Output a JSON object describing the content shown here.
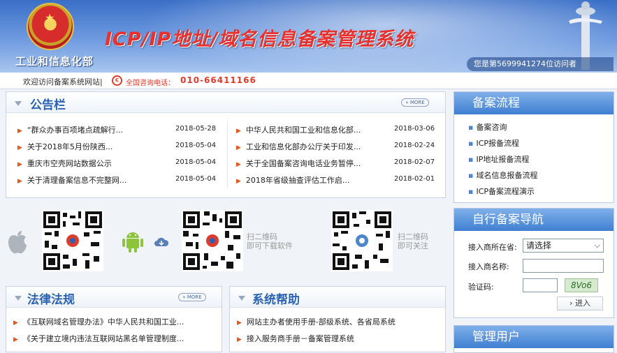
{
  "header": {
    "ministry": "工业和信息化部",
    "title": "ICP/IP地址/域名信息备案管理系统",
    "visitor": "您是第5699941274位访问者"
  },
  "subbar": {
    "welcome": "欢迎访问备案系统网站|",
    "phone_label": "全国咨询电话：",
    "phone_number": "010-66411166"
  },
  "notice": {
    "title": "公告栏",
    "more": "MORE",
    "left": [
      {
        "text": "“群众办事百项堵点疏解行...",
        "date": "2018-05-28"
      },
      {
        "text": "关于2018年5月份陕西...",
        "date": "2018-05-04"
      },
      {
        "text": "重庆市空壳网站数据公示",
        "date": "2018-05-04"
      },
      {
        "text": "关于清理备案信息不完整网...",
        "date": "2018-05-04"
      }
    ],
    "right": [
      {
        "text": "中华人民共和国工业和信息化部...",
        "date": "2018-03-06"
      },
      {
        "text": "工业和信息化部办公厅关于印发...",
        "date": "2018-02-24"
      },
      {
        "text": "关于全国备案咨询电话业务暂停...",
        "date": "2018-02-07"
      },
      {
        "text": "2018年省级抽查评估工作启...",
        "date": "2018-02-01"
      }
    ]
  },
  "qr": {
    "download": [
      "扫二维码",
      "即可下载软件"
    ],
    "follow": [
      "扫二维码",
      "即可关注"
    ]
  },
  "law": {
    "title": "法律法规",
    "more": "MORE",
    "items": [
      "《互联网域名管理办法》中华人民共和国工业...",
      "《关于建立境内违法互联网站黑名单管理制度..."
    ]
  },
  "help": {
    "title": "系统帮助",
    "items": [
      "网站主办者使用手册-部级系统、各省局系统",
      "接入服务商手册－备案管理系统"
    ]
  },
  "process": {
    "title": "备案流程",
    "items": [
      "备案咨询",
      "ICP报备流程",
      "IP地址报备流程",
      "域名信息报备流程",
      "ICP备案流程演示"
    ]
  },
  "nav": {
    "title": "自行备案导航",
    "provider_location_label": "接入商所在省:",
    "provider_location_value": "请选择",
    "provider_name_label": "接入商名称:",
    "captcha_label": "验证码:",
    "captcha_text": "8Vo6",
    "enter": "进入"
  },
  "admin": {
    "title": "管理用户"
  },
  "colors": {
    "accent": "#2b63b4",
    "title_red": "#e8312f",
    "arrow": "#e05a1f"
  }
}
